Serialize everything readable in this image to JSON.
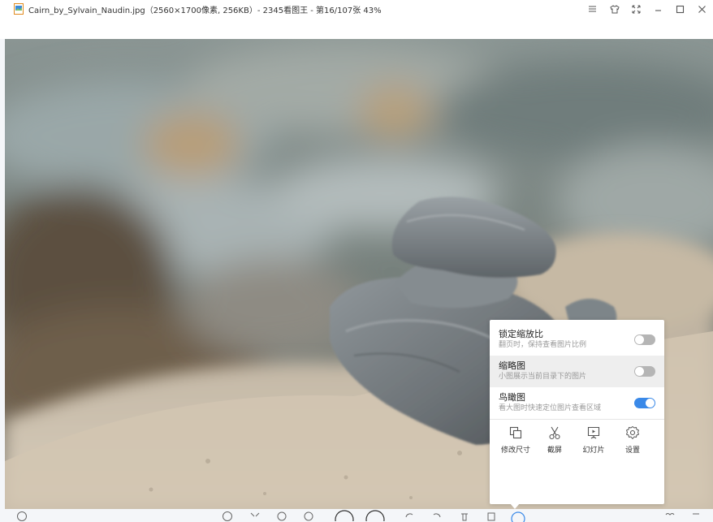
{
  "window": {
    "title": "Cairn_by_Sylvain_Naudin.jpg（2560×1700像素, 256KB）- 2345看图王 - 第16/107张 43%",
    "controls": [
      "menu-icon",
      "skin-icon",
      "fullscreen-icon",
      "minimize-icon",
      "maximize-icon",
      "close-icon"
    ]
  },
  "settings_popup": {
    "options": [
      {
        "title": "锁定缩放比",
        "desc": "翻页时，保持查看图片比例",
        "enabled": false
      },
      {
        "title": "缩略图",
        "desc": "小图展示当前目录下的图片",
        "enabled": false
      },
      {
        "title": "鸟瞰图",
        "desc": "看大图时快速定位图片查看区域",
        "enabled": true
      }
    ],
    "tools": [
      {
        "label": "修改尺寸",
        "icon": "resize-icon"
      },
      {
        "label": "截屏",
        "icon": "scissors-icon"
      },
      {
        "label": "幻灯片",
        "icon": "slideshow-icon"
      },
      {
        "label": "设置",
        "icon": "gear-icon"
      }
    ]
  },
  "colors": {
    "accent": "#3a89e8",
    "toggle_off": "#b5b5b5",
    "popup_bg": "#ffffff"
  }
}
